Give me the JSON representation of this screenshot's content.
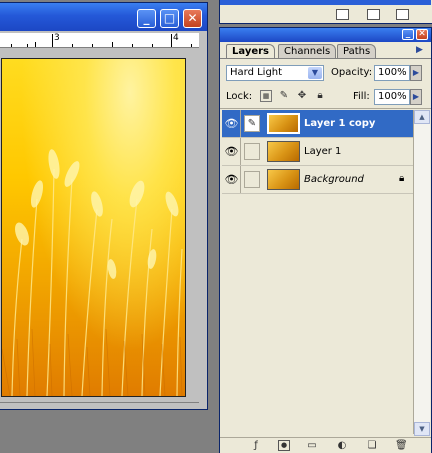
{
  "document": {
    "ruler_labels": [
      "3",
      "4"
    ],
    "window_buttons": {
      "minimize": "_",
      "maximize": "□",
      "close": "✕"
    }
  },
  "layers_palette": {
    "tabs": [
      {
        "label": "Layers",
        "active": true
      },
      {
        "label": "Channels",
        "active": false
      },
      {
        "label": "Paths",
        "active": false
      }
    ],
    "blend_mode": "Hard Light",
    "opacity_label": "Opacity:",
    "opacity_value": "100%",
    "lock_label": "Lock:",
    "fill_label": "Fill:",
    "fill_value": "100%",
    "layers": [
      {
        "name": "Layer 1 copy",
        "selected": true,
        "visible": true,
        "brush": true,
        "italic": false,
        "locked": false
      },
      {
        "name": "Layer 1",
        "selected": false,
        "visible": true,
        "brush": false,
        "italic": false,
        "locked": false
      },
      {
        "name": "Background",
        "selected": false,
        "visible": true,
        "brush": false,
        "italic": true,
        "locked": true
      }
    ]
  },
  "icons": {
    "eye": "eye-icon",
    "brush": "brush-icon",
    "lock": "lock-icon",
    "menu": "palette-menu-arrow-icon"
  },
  "colors": {
    "titlebar": "#2458d8",
    "selection": "#316ac5",
    "panel": "#ece9d8",
    "photo": "#ffc800"
  }
}
